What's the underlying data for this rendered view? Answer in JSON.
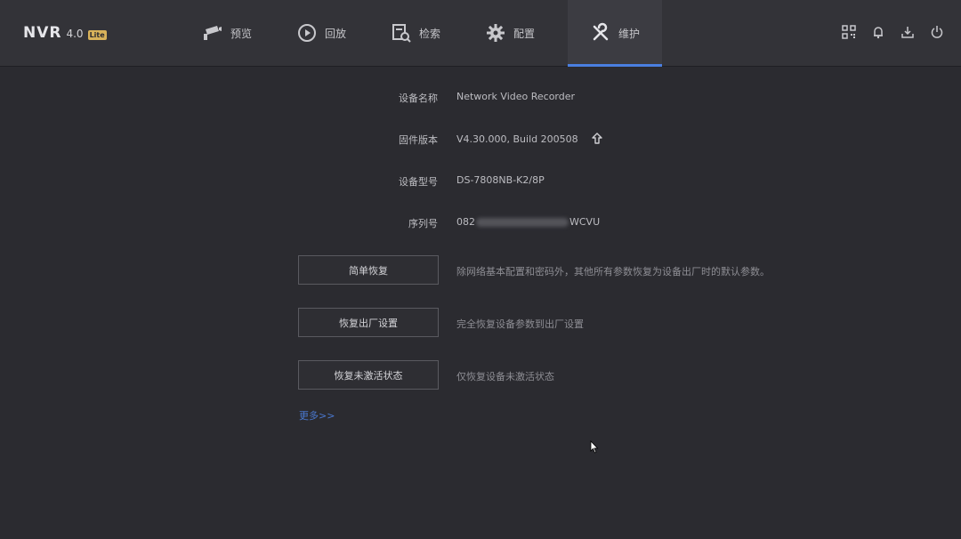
{
  "logo": {
    "name": "NVR",
    "version": "4.0",
    "edition": "Lite"
  },
  "nav": {
    "items": [
      {
        "label": "预览",
        "icon": "camera-icon"
      },
      {
        "label": "回放",
        "icon": "playback-icon"
      },
      {
        "label": "检索",
        "icon": "search-file-icon"
      },
      {
        "label": "配置",
        "icon": "gear-icon"
      },
      {
        "label": "维护",
        "icon": "wrench-icon",
        "active": true
      }
    ]
  },
  "top_icons": [
    "qrcode-icon",
    "bell-icon",
    "download-icon",
    "power-icon"
  ],
  "device_info": {
    "name": {
      "label": "设备名称",
      "value": "Network Video Recorder"
    },
    "firmware": {
      "label": "固件版本",
      "value": "V4.30.000, Build 200508"
    },
    "model": {
      "label": "设备型号",
      "value": "DS-7808NB-K2/8P"
    },
    "serial": {
      "label": "序列号",
      "value_prefix": "082",
      "value_suffix": "WCVU"
    }
  },
  "actions": [
    {
      "label": "简单恢复",
      "desc": "除网络基本配置和密码外，其他所有参数恢复为设备出厂时的默认参数。"
    },
    {
      "label": "恢复出厂设置",
      "desc": "完全恢复设备参数到出厂设置"
    },
    {
      "label": "恢复未激活状态",
      "desc": "仅恢复设备未激活状态"
    }
  ],
  "more_link": "更多>>",
  "colors": {
    "accent": "#4a7fe0",
    "link": "#4a78cf",
    "background": "#2b2b30",
    "topbar": "#333338"
  }
}
